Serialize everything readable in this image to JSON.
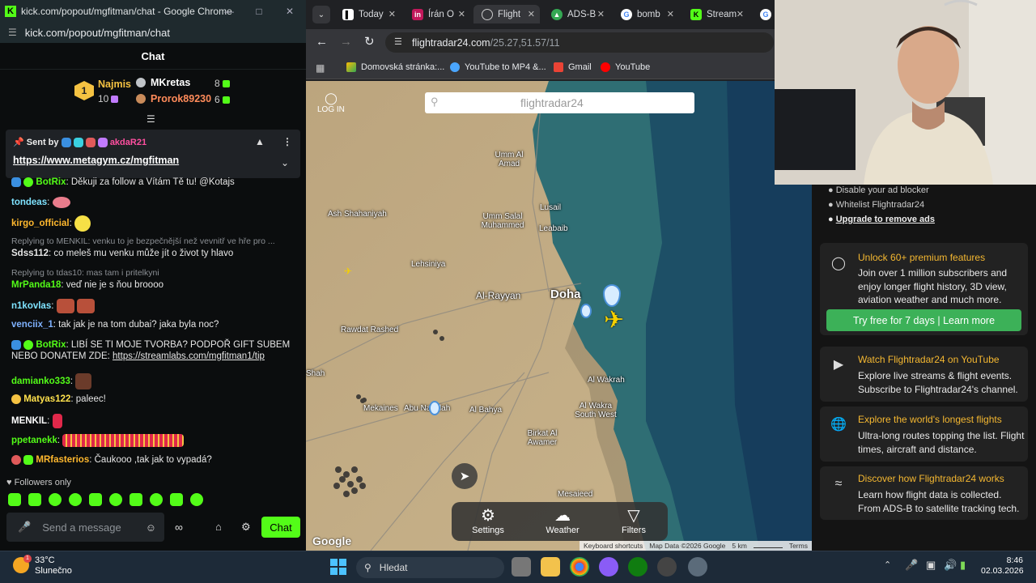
{
  "chat_window": {
    "title": "kick.com/popout/mgfitman/chat - Google Chrome",
    "address": "kick.com/popout/mgfitman/chat",
    "header": "Chat",
    "leaderboard": [
      {
        "rank": "1",
        "name": "Najmis",
        "count": "10"
      },
      {
        "name": "MKretas",
        "count": "8"
      },
      {
        "name": "Prorok89230",
        "count": "6"
      }
    ],
    "pinned": {
      "sent_by_label": "Sent by",
      "sender": "akdaR21",
      "link": "https://www.metagym.cz/mgfitman"
    },
    "messages": [
      {
        "user": "BotRix",
        "text": ": Děkuji za follow a Vítám Tě tu! @Kotajs",
        "color": "#53fc18"
      },
      {
        "user": "tondeas",
        "text": ":",
        "color": "#7fe3ff"
      },
      {
        "user": "kirgo_official",
        "text": ":",
        "color": "#ffb82e"
      },
      {
        "reply": "Replying to MENKIL: venku to je bezpečnější než vevnitř ve hře pro ...",
        "user": "Sdss112",
        "text": ": co meleš mu venku může jít o život ty hlavo",
        "color": "#e6e6e6"
      },
      {
        "reply": "Replying to tdas10: mas tam i pritelkyni",
        "user": "MrPanda18",
        "text": ": veď nie je s ňou broooo",
        "color": "#53fc18"
      },
      {
        "user": "n1kovlas",
        "text": ":",
        "color": "#7fe3ff"
      },
      {
        "user": "venciix_1",
        "text": ": tak jak je na tom dubai? jaka byla noc?",
        "color": "#7fb2ff"
      },
      {
        "user": "BotRix",
        "text": ": LIBÍ SE TI MOJE TVORBA? PODPOŘ GIFT SUBEM NEBO DONATEM ZDE: ",
        "link": "https://streamlabs.com/mgfitman1/tip",
        "color": "#53fc18"
      },
      {
        "user": "damianko333",
        "text": ":",
        "color": "#53fc18"
      },
      {
        "user": "Matyas122",
        "text": ": paleec!",
        "color": "#ffe14d"
      },
      {
        "user": "MENKIL",
        "text": ":",
        "color": "#ffffff"
      },
      {
        "user": "ppetanekk",
        "text": ":",
        "color": "#53fc18"
      },
      {
        "user": "MRfasterios",
        "text": ": Čaukooo ,tak jak to vypadá?",
        "color": "#ffb82e"
      }
    ],
    "followers_only": "Followers only",
    "message_placeholder": "Send a message",
    "chat_button": "Chat"
  },
  "browser": {
    "tabs": [
      {
        "label": "Today",
        "icon_color": "#ffffff"
      },
      {
        "label": "Írán O",
        "icon_color": "#c2185b"
      },
      {
        "label": "Flight",
        "icon_color": "#9aa0a6",
        "active": true
      },
      {
        "label": "ADS-B",
        "icon_color": "#34a853"
      },
      {
        "label": "bomb",
        "icon_color": "#4285f4"
      },
      {
        "label": "Stream",
        "icon_color": "#53fc18"
      }
    ],
    "url": "flightradar24.com/25.27,51.57/11",
    "url_domain": "flightradar24.com",
    "url_path": "/25.27,51.57/11",
    "bookmarks": [
      "Domovská stránka:...",
      "YouTube to MP4 &...",
      "Gmail",
      "YouTube"
    ]
  },
  "map": {
    "login": "LOG IN",
    "search_logo": "flightradar24",
    "labels": [
      {
        "text": "Umm Al Amad"
      },
      {
        "text": "Ash Shahaniyah"
      },
      {
        "text": "Umm Salal Muhammed"
      },
      {
        "text": "Lusail"
      },
      {
        "text": "Leabaib"
      },
      {
        "text": "Lehsiniya"
      },
      {
        "text": "Al-Rayyan"
      },
      {
        "text": "Doha"
      },
      {
        "text": "Rawdat Rashed"
      },
      {
        "text": "Al Wakrah"
      },
      {
        "text": "Al Wakra South West"
      },
      {
        "text": "Mekaines"
      },
      {
        "text": "Abu Nakhlah"
      },
      {
        "text": "Al Bahya"
      },
      {
        "text": "Birkat Al Awamer"
      },
      {
        "text": "Mesaieed"
      },
      {
        "text": "Shah"
      }
    ],
    "bottom_bar": [
      "Settings",
      "Weather",
      "Filters"
    ],
    "footer": {
      "google": "Google",
      "shortcuts": "Keyboard shortcuts",
      "mapdata": "Map Data ©2026 Google",
      "scale": "5 km",
      "terms": "Terms"
    }
  },
  "panel": {
    "adblock": [
      "Disable your ad blocker",
      "Whitelist Flightradar24",
      "Upgrade to remove ads"
    ],
    "premium": {
      "title": "Unlock 60+ premium features",
      "text": "Join over 1 million subscribers and enjoy longer flight history, 3D view, aviation weather and much more.",
      "cta": "Try free for 7 days | Learn more"
    },
    "cards": [
      {
        "title": "Watch Flightradar24 on YouTube",
        "text": "Explore live streams & flight events. Subscribe to Flightradar24's channel."
      },
      {
        "title": "Explore the world's longest flights",
        "text": "Ultra-long routes topping the list. Flight times, aircraft and distance."
      },
      {
        "title": "Discover how Flightradar24 works",
        "text": "Learn how flight data is collected. From ADS-B to satellite tracking tech."
      }
    ]
  },
  "taskbar": {
    "weather_temp": "33°C",
    "weather_desc": "Slunečno",
    "search": "Hledat",
    "time": "8:46",
    "date": "02.03.2026"
  }
}
